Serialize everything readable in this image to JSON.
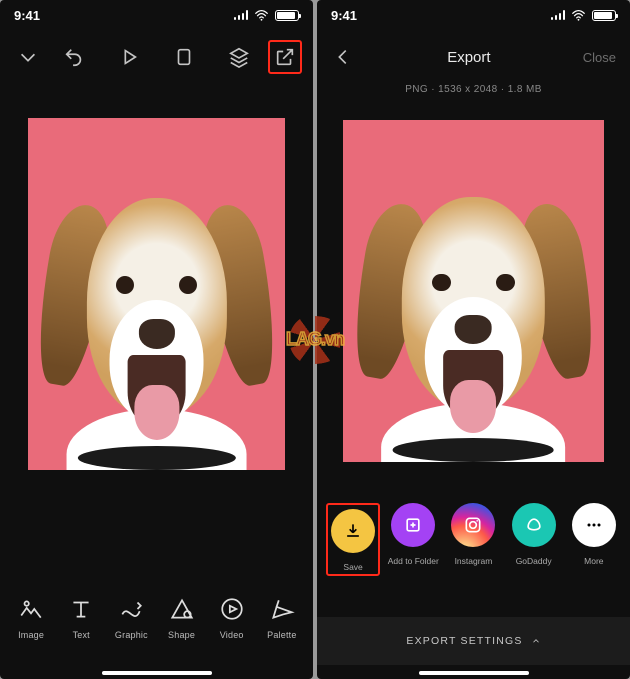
{
  "status": {
    "time": "9:41"
  },
  "left": {
    "tools": [
      {
        "name": "image",
        "label": "Image"
      },
      {
        "name": "text",
        "label": "Text"
      },
      {
        "name": "graphic",
        "label": "Graphic"
      },
      {
        "name": "shape",
        "label": "Shape"
      },
      {
        "name": "video",
        "label": "Video"
      },
      {
        "name": "palette",
        "label": "Palette"
      }
    ]
  },
  "right": {
    "header": {
      "title": "Export",
      "close": "Close"
    },
    "file_info": "PNG · 1536 x 2048 · 1.8 MB",
    "actions": [
      {
        "name": "save",
        "label": "Save",
        "color": "#f4c542"
      },
      {
        "name": "add-folder",
        "label": "Add to Folder",
        "color": "#a442f4"
      },
      {
        "name": "instagram",
        "label": "Instagram",
        "color": "#d6249f"
      },
      {
        "name": "godaddy",
        "label": "GoDaddy",
        "color": "#1bc7b3"
      },
      {
        "name": "more",
        "label": "More",
        "color": "#ffffff"
      }
    ],
    "export_settings": "EXPORT SETTINGS"
  },
  "watermark": "LAG.vn"
}
